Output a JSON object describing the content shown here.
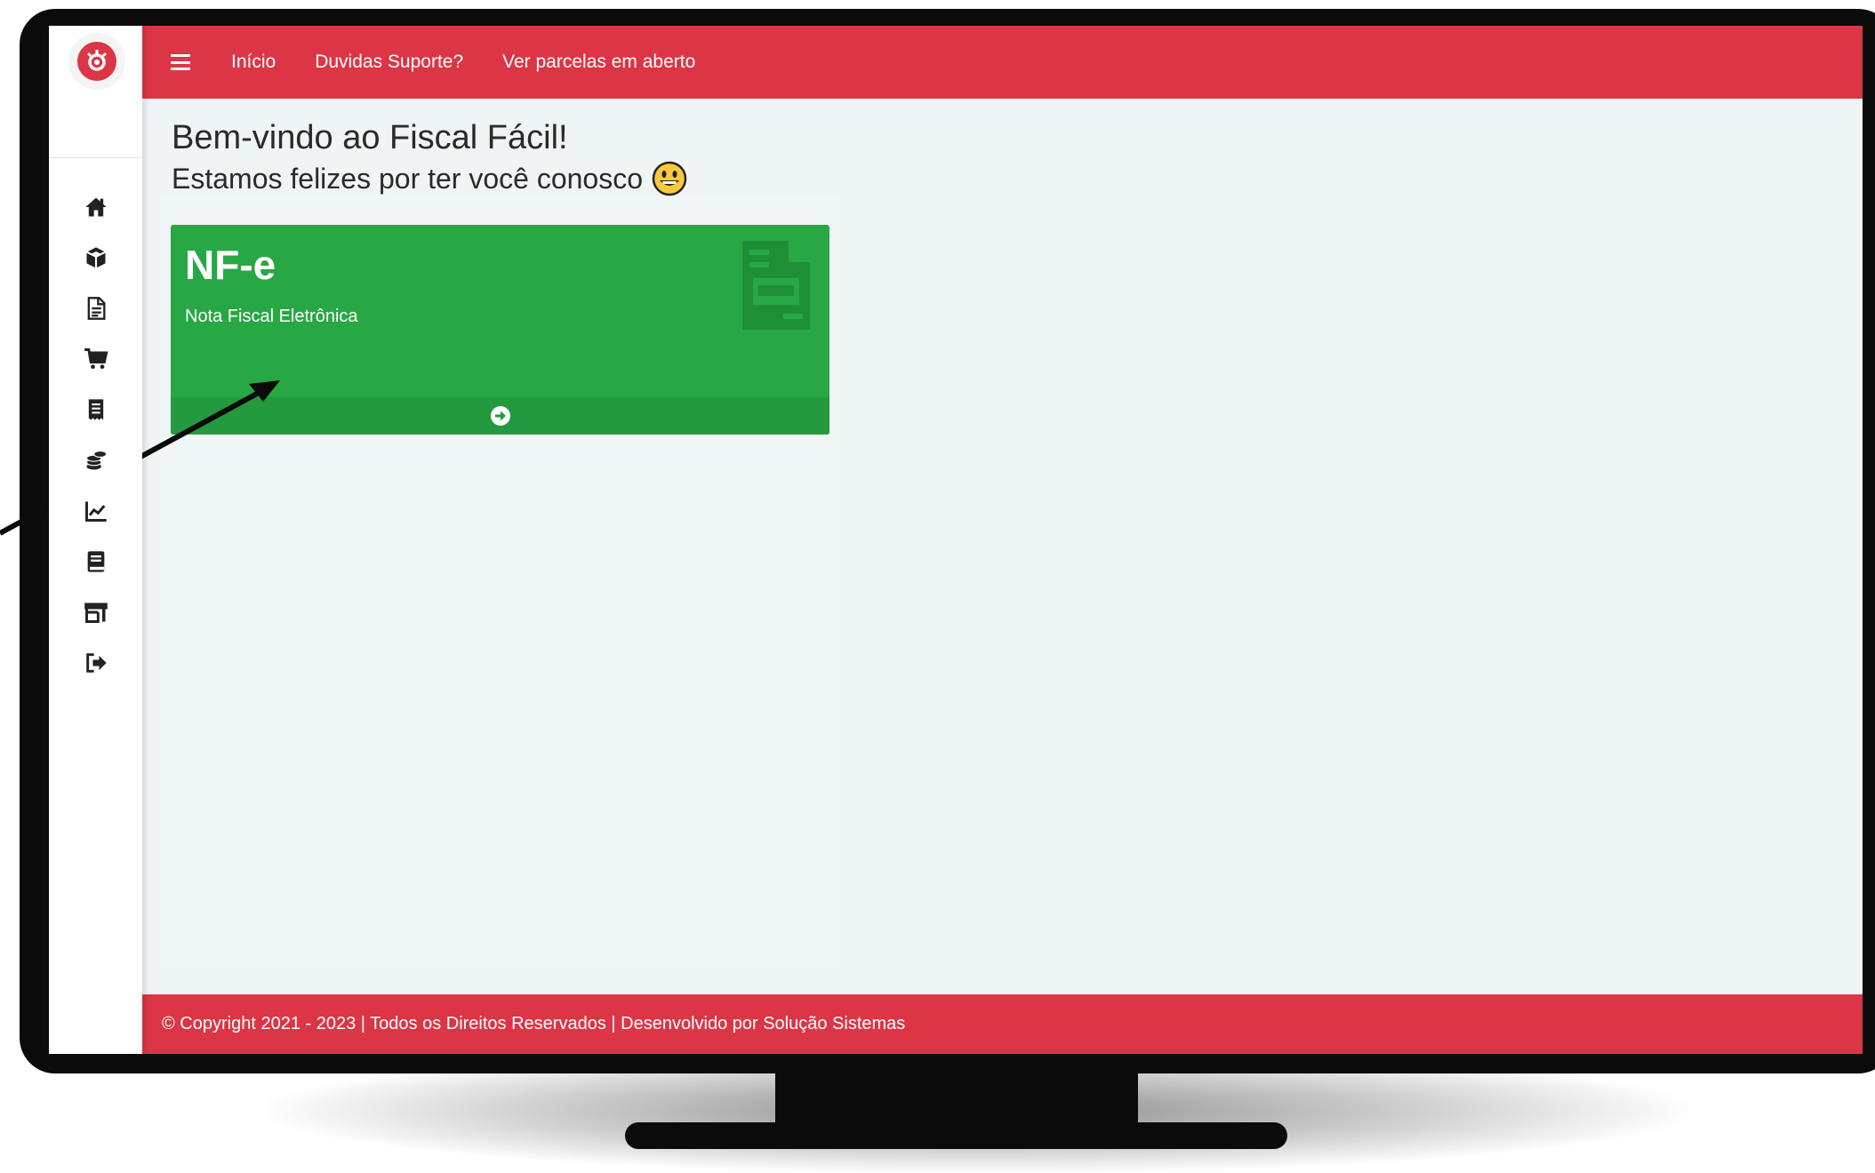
{
  "topbar": {
    "menu_icon": "hamburger-icon",
    "links": [
      "Início",
      "Duvidas Suporte?",
      "Ver parcelas em aberto"
    ],
    "color": "#dc3545"
  },
  "sidebar": {
    "logo": "brand-logo",
    "items": [
      {
        "icon": "home-icon"
      },
      {
        "icon": "box-icon"
      },
      {
        "icon": "document-icon"
      },
      {
        "icon": "cart-icon"
      },
      {
        "icon": "receipt-icon"
      },
      {
        "icon": "coins-icon"
      },
      {
        "icon": "chart-line-icon"
      },
      {
        "icon": "book-icon"
      },
      {
        "icon": "store-icon"
      },
      {
        "icon": "sign-out-icon"
      }
    ]
  },
  "main": {
    "welcome_title": "Bem-vindo ao Fiscal Fácil!",
    "welcome_subtitle": "Estamos felizes por ter você conosco",
    "emoji_icon": "smiley-emoji-icon",
    "card": {
      "title": "NF-e",
      "subtitle": "Nota Fiscal Eletrônica",
      "icon": "file-invoice-icon",
      "footer_icon": "arrow-circle-right-icon",
      "color": "#28a745"
    }
  },
  "footer": {
    "text": "© Copyright 2021 - 2023 | Todos os Direitos Reservados | Desenvolvido por Solução Sistemas"
  }
}
